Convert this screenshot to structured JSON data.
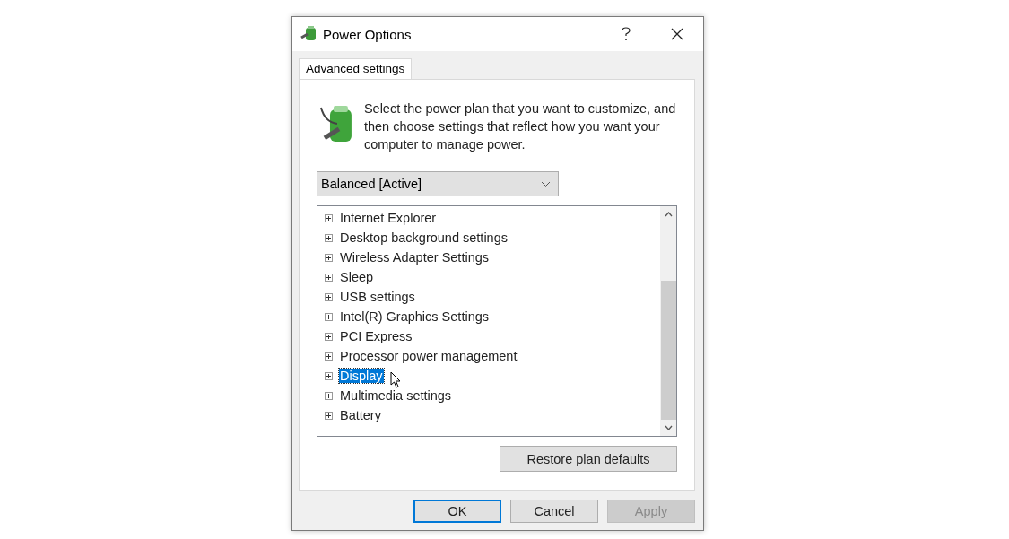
{
  "window": {
    "title": "Power Options"
  },
  "tabs": [
    {
      "label": "Advanced settings",
      "selected": true
    }
  ],
  "message": "Select the power plan that you want to customize, and then choose settings that reflect how you want your computer to manage power.",
  "plan_dropdown": {
    "value": "Balanced [Active]"
  },
  "settings_tree": [
    {
      "label": "Internet Explorer",
      "expanded": false,
      "selected": false
    },
    {
      "label": "Desktop background settings",
      "expanded": false,
      "selected": false
    },
    {
      "label": "Wireless Adapter Settings",
      "expanded": false,
      "selected": false
    },
    {
      "label": "Sleep",
      "expanded": false,
      "selected": false
    },
    {
      "label": "USB settings",
      "expanded": false,
      "selected": false
    },
    {
      "label": "Intel(R) Graphics Settings",
      "expanded": false,
      "selected": false
    },
    {
      "label": "PCI Express",
      "expanded": false,
      "selected": false
    },
    {
      "label": "Processor power management",
      "expanded": false,
      "selected": false
    },
    {
      "label": "Display",
      "expanded": false,
      "selected": true
    },
    {
      "label": "Multimedia settings",
      "expanded": false,
      "selected": false
    },
    {
      "label": "Battery",
      "expanded": false,
      "selected": false
    }
  ],
  "restore_button": "Restore plan defaults",
  "buttons": [
    {
      "label": "OK",
      "kind": "default",
      "disabled": false
    },
    {
      "label": "Cancel",
      "kind": "normal",
      "disabled": false
    },
    {
      "label": "Apply",
      "kind": "normal",
      "disabled": true
    }
  ]
}
